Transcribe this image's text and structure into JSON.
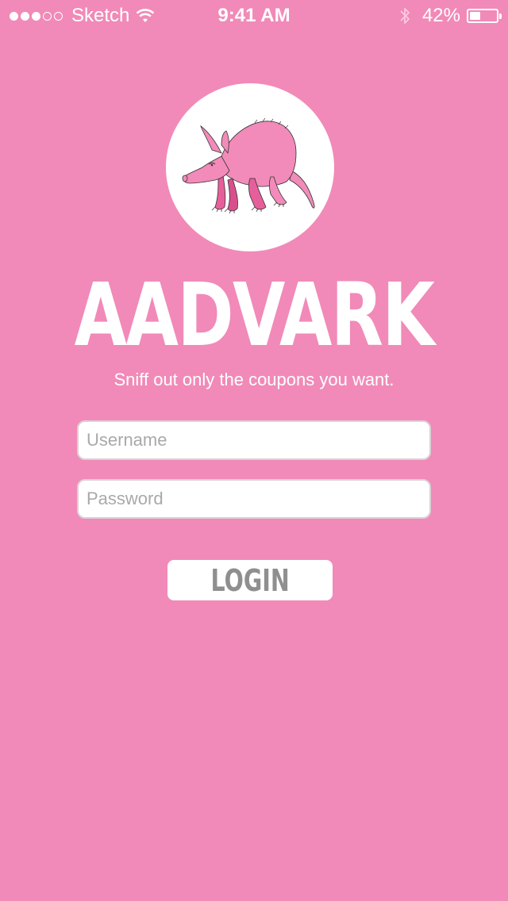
{
  "status_bar": {
    "signal_filled": 3,
    "signal_total": 5,
    "carrier": "Sketch",
    "time": "9:41 AM",
    "battery_percent": "42%",
    "battery_level": 0.42,
    "icons": [
      "wifi-icon",
      "bluetooth-icon",
      "battery-icon"
    ]
  },
  "app": {
    "name": "AADVARK",
    "tagline": "Sniff out only the coupons you want.",
    "logo_icon": "aardvark-logo"
  },
  "login_form": {
    "username_placeholder": "Username",
    "username_value": "",
    "password_placeholder": "Password",
    "password_value": "",
    "login_label": "LOGIN"
  },
  "colors": {
    "background": "#F18AB8",
    "text": "#FFFFFF",
    "button_text": "#8F8F8F"
  }
}
